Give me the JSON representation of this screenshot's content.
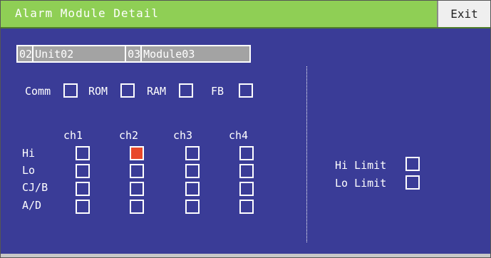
{
  "window": {
    "title": "Alarm Module Detail",
    "exit_label": "Exit"
  },
  "selector": {
    "unit_no": "02",
    "unit_name": "Unit02",
    "module_no": "03",
    "module_name": "Module03"
  },
  "status": {
    "items": [
      {
        "label": "Comm",
        "active": false
      },
      {
        "label": "ROM",
        "active": false
      },
      {
        "label": "RAM",
        "active": false
      },
      {
        "label": "FB",
        "active": false
      }
    ]
  },
  "channels": {
    "headers": [
      "ch1",
      "ch2",
      "ch3",
      "ch4"
    ],
    "rows": [
      {
        "label": "Hi",
        "states": [
          false,
          true,
          false,
          false
        ]
      },
      {
        "label": "Lo",
        "states": [
          false,
          false,
          false,
          false
        ]
      },
      {
        "label": "CJ/B",
        "states": [
          false,
          false,
          false,
          false
        ]
      },
      {
        "label": "A/D",
        "states": [
          false,
          false,
          false,
          false
        ]
      }
    ]
  },
  "limits": [
    {
      "label": "Hi Limit",
      "active": false
    },
    {
      "label": "Lo Limit",
      "active": false
    }
  ],
  "colors": {
    "background": "#3a3c97",
    "title_bar": "#8fcf55",
    "alarm_on": "#e8482a"
  }
}
